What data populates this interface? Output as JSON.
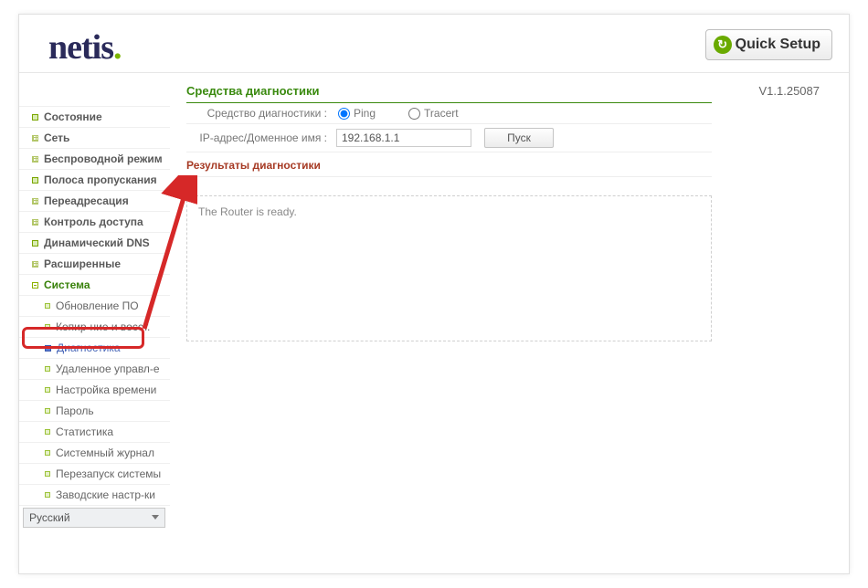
{
  "header": {
    "logo_text": "netis",
    "quick_setup_label": "Quick Setup"
  },
  "version": "V1.1.25087",
  "sidebar": {
    "items": [
      {
        "label": "Состояние"
      },
      {
        "label": "Сеть"
      },
      {
        "label": "Беспроводной режим"
      },
      {
        "label": "Полоса пропускания"
      },
      {
        "label": "Переадресация"
      },
      {
        "label": "Контроль доступа"
      },
      {
        "label": "Динамический DNS"
      },
      {
        "label": "Расширенные"
      },
      {
        "label": "Система"
      }
    ],
    "system_sub": [
      {
        "label": "Обновление ПО"
      },
      {
        "label": "Копир-ние и восст."
      },
      {
        "label": "Диагностика"
      },
      {
        "label": "Удаленное управл-е"
      },
      {
        "label": "Настройка времени"
      },
      {
        "label": "Пароль"
      },
      {
        "label": "Статистика"
      },
      {
        "label": "Системный журнал"
      },
      {
        "label": "Перезапуск системы"
      },
      {
        "label": "Заводские настр-ки"
      }
    ],
    "language": "Русский"
  },
  "main": {
    "title": "Средства диагностики",
    "tool_label": "Средство диагностики :",
    "radio_ping": "Ping",
    "radio_tracert": "Tracert",
    "ip_label": "IP-адрес/Доменное имя :",
    "ip_value": "192.168.1.1",
    "start_button": "Пуск",
    "result_title": "Результаты диагностики",
    "result_text": "The Router is ready."
  }
}
